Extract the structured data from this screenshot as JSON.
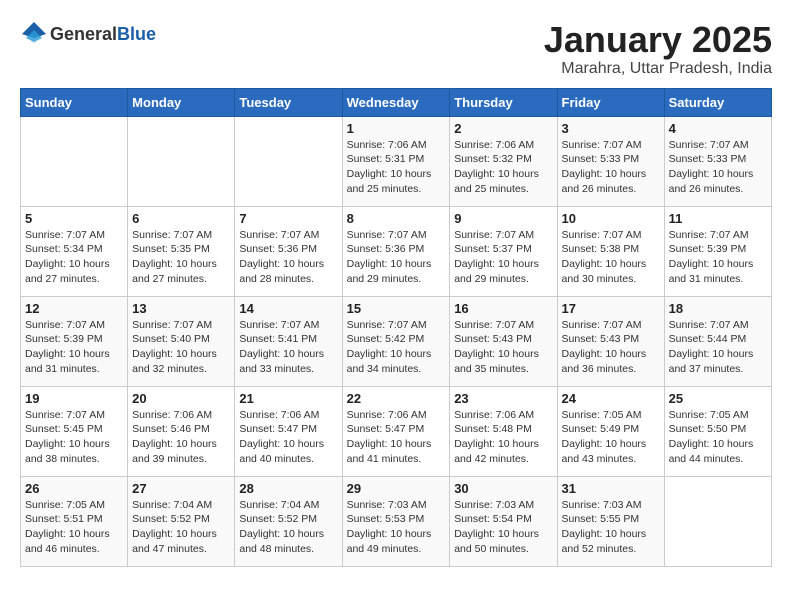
{
  "header": {
    "logo_general": "General",
    "logo_blue": "Blue",
    "title": "January 2025",
    "subtitle": "Marahra, Uttar Pradesh, India"
  },
  "weekdays": [
    "Sunday",
    "Monday",
    "Tuesday",
    "Wednesday",
    "Thursday",
    "Friday",
    "Saturday"
  ],
  "weeks": [
    [
      {
        "day": "",
        "info": ""
      },
      {
        "day": "",
        "info": ""
      },
      {
        "day": "",
        "info": ""
      },
      {
        "day": "1",
        "info": "Sunrise: 7:06 AM\nSunset: 5:31 PM\nDaylight: 10 hours\nand 25 minutes."
      },
      {
        "day": "2",
        "info": "Sunrise: 7:06 AM\nSunset: 5:32 PM\nDaylight: 10 hours\nand 25 minutes."
      },
      {
        "day": "3",
        "info": "Sunrise: 7:07 AM\nSunset: 5:33 PM\nDaylight: 10 hours\nand 26 minutes."
      },
      {
        "day": "4",
        "info": "Sunrise: 7:07 AM\nSunset: 5:33 PM\nDaylight: 10 hours\nand 26 minutes."
      }
    ],
    [
      {
        "day": "5",
        "info": "Sunrise: 7:07 AM\nSunset: 5:34 PM\nDaylight: 10 hours\nand 27 minutes."
      },
      {
        "day": "6",
        "info": "Sunrise: 7:07 AM\nSunset: 5:35 PM\nDaylight: 10 hours\nand 27 minutes."
      },
      {
        "day": "7",
        "info": "Sunrise: 7:07 AM\nSunset: 5:36 PM\nDaylight: 10 hours\nand 28 minutes."
      },
      {
        "day": "8",
        "info": "Sunrise: 7:07 AM\nSunset: 5:36 PM\nDaylight: 10 hours\nand 29 minutes."
      },
      {
        "day": "9",
        "info": "Sunrise: 7:07 AM\nSunset: 5:37 PM\nDaylight: 10 hours\nand 29 minutes."
      },
      {
        "day": "10",
        "info": "Sunrise: 7:07 AM\nSunset: 5:38 PM\nDaylight: 10 hours\nand 30 minutes."
      },
      {
        "day": "11",
        "info": "Sunrise: 7:07 AM\nSunset: 5:39 PM\nDaylight: 10 hours\nand 31 minutes."
      }
    ],
    [
      {
        "day": "12",
        "info": "Sunrise: 7:07 AM\nSunset: 5:39 PM\nDaylight: 10 hours\nand 31 minutes."
      },
      {
        "day": "13",
        "info": "Sunrise: 7:07 AM\nSunset: 5:40 PM\nDaylight: 10 hours\nand 32 minutes."
      },
      {
        "day": "14",
        "info": "Sunrise: 7:07 AM\nSunset: 5:41 PM\nDaylight: 10 hours\nand 33 minutes."
      },
      {
        "day": "15",
        "info": "Sunrise: 7:07 AM\nSunset: 5:42 PM\nDaylight: 10 hours\nand 34 minutes."
      },
      {
        "day": "16",
        "info": "Sunrise: 7:07 AM\nSunset: 5:43 PM\nDaylight: 10 hours\nand 35 minutes."
      },
      {
        "day": "17",
        "info": "Sunrise: 7:07 AM\nSunset: 5:43 PM\nDaylight: 10 hours\nand 36 minutes."
      },
      {
        "day": "18",
        "info": "Sunrise: 7:07 AM\nSunset: 5:44 PM\nDaylight: 10 hours\nand 37 minutes."
      }
    ],
    [
      {
        "day": "19",
        "info": "Sunrise: 7:07 AM\nSunset: 5:45 PM\nDaylight: 10 hours\nand 38 minutes."
      },
      {
        "day": "20",
        "info": "Sunrise: 7:06 AM\nSunset: 5:46 PM\nDaylight: 10 hours\nand 39 minutes."
      },
      {
        "day": "21",
        "info": "Sunrise: 7:06 AM\nSunset: 5:47 PM\nDaylight: 10 hours\nand 40 minutes."
      },
      {
        "day": "22",
        "info": "Sunrise: 7:06 AM\nSunset: 5:47 PM\nDaylight: 10 hours\nand 41 minutes."
      },
      {
        "day": "23",
        "info": "Sunrise: 7:06 AM\nSunset: 5:48 PM\nDaylight: 10 hours\nand 42 minutes."
      },
      {
        "day": "24",
        "info": "Sunrise: 7:05 AM\nSunset: 5:49 PM\nDaylight: 10 hours\nand 43 minutes."
      },
      {
        "day": "25",
        "info": "Sunrise: 7:05 AM\nSunset: 5:50 PM\nDaylight: 10 hours\nand 44 minutes."
      }
    ],
    [
      {
        "day": "26",
        "info": "Sunrise: 7:05 AM\nSunset: 5:51 PM\nDaylight: 10 hours\nand 46 minutes."
      },
      {
        "day": "27",
        "info": "Sunrise: 7:04 AM\nSunset: 5:52 PM\nDaylight: 10 hours\nand 47 minutes."
      },
      {
        "day": "28",
        "info": "Sunrise: 7:04 AM\nSunset: 5:52 PM\nDaylight: 10 hours\nand 48 minutes."
      },
      {
        "day": "29",
        "info": "Sunrise: 7:03 AM\nSunset: 5:53 PM\nDaylight: 10 hours\nand 49 minutes."
      },
      {
        "day": "30",
        "info": "Sunrise: 7:03 AM\nSunset: 5:54 PM\nDaylight: 10 hours\nand 50 minutes."
      },
      {
        "day": "31",
        "info": "Sunrise: 7:03 AM\nSunset: 5:55 PM\nDaylight: 10 hours\nand 52 minutes."
      },
      {
        "day": "",
        "info": ""
      }
    ]
  ]
}
